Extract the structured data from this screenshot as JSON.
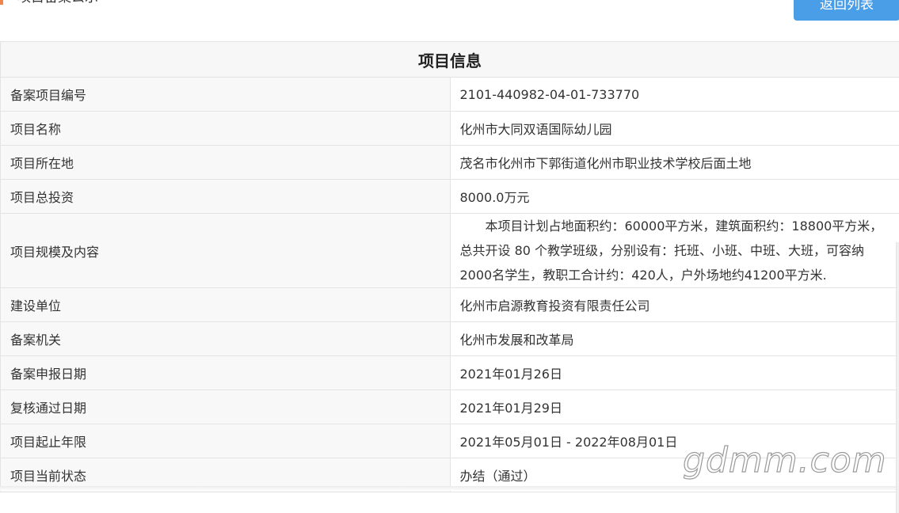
{
  "header": {
    "title": "项目备案公示",
    "back_label": "返回列表"
  },
  "table": {
    "title": "项目信息",
    "rows": [
      {
        "label": "备案项目编号",
        "value": "2101-440982-04-01-733770"
      },
      {
        "label": "项目名称",
        "value": "化州市大同双语国际幼儿园"
      },
      {
        "label": "项目所在地",
        "value": "茂名市化州市下郭街道化州市职业技术学校后面土地"
      },
      {
        "label": "项目总投资",
        "value": "8000.0万元"
      },
      {
        "label": "项目规模及内容",
        "value": "本项目计划占地面积约：60000平方米，建筑面积约：18800平方米，总共开设 80 个教学班级，分别设有：托班、小班、中班、大班，可容纳2000名学生，教职工合计约：420人，户外场地约41200平方米."
      },
      {
        "label": "建设单位",
        "value": "化州市启源教育投资有限责任公司"
      },
      {
        "label": "备案机关",
        "value": "化州市发展和改革局"
      },
      {
        "label": "备案申报日期",
        "value": "2021年01月26日"
      },
      {
        "label": "复核通过日期",
        "value": "2021年01月29日"
      },
      {
        "label": "项目起止年限",
        "value": "2021年05月01日 - 2022年08月01日"
      },
      {
        "label": "项目当前状态",
        "value": "办结（通过）"
      }
    ]
  },
  "watermark": "gdmm.com"
}
